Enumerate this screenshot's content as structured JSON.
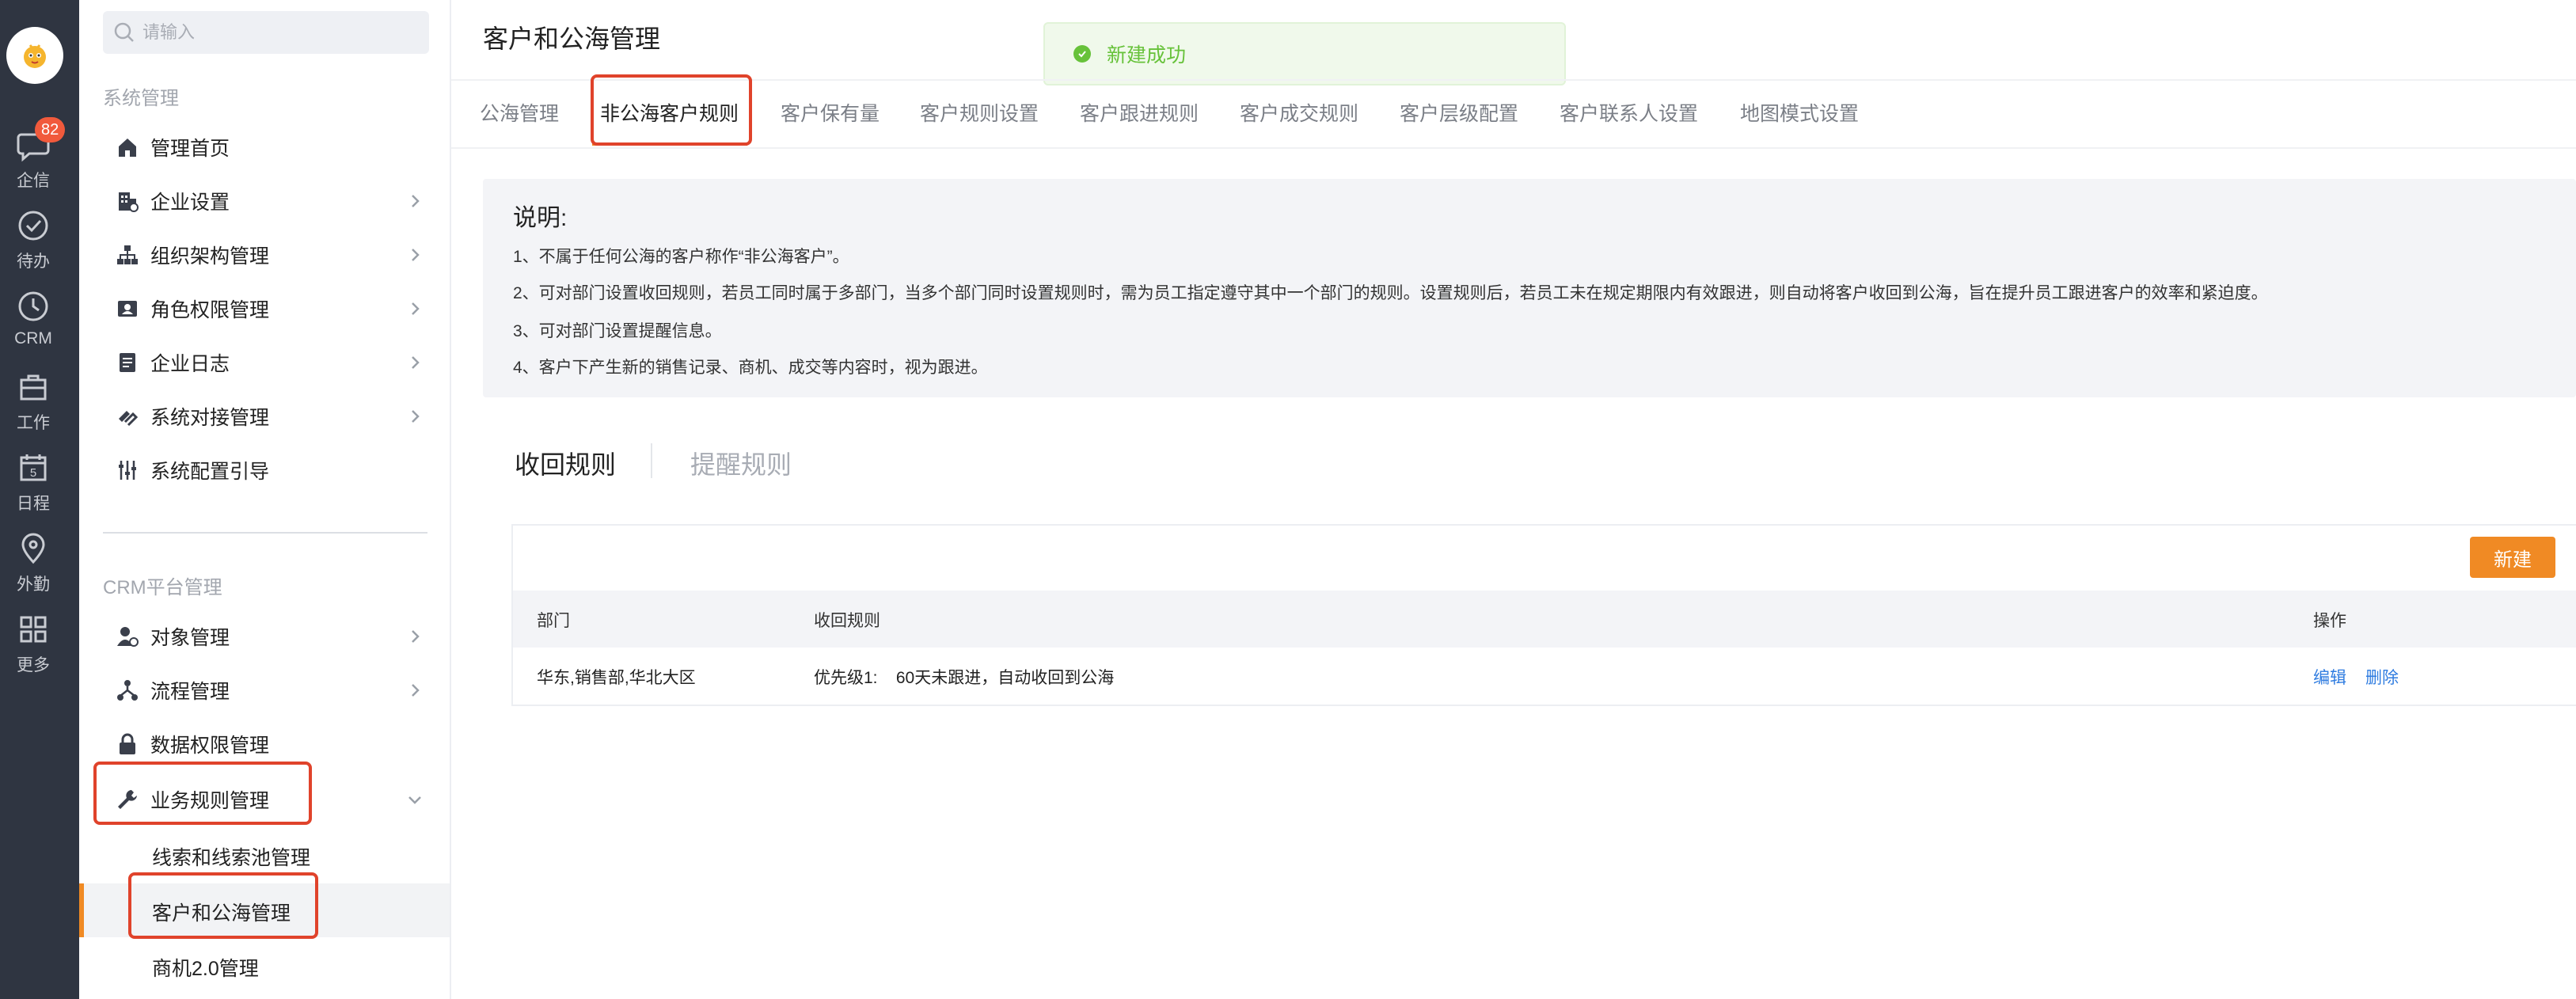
{
  "rail": {
    "badge": "82",
    "items": [
      {
        "label": "企信",
        "icon": "chat-icon"
      },
      {
        "label": "待办",
        "icon": "check-circle-icon"
      },
      {
        "label": "CRM",
        "icon": "clock-icon"
      },
      {
        "label": "工作",
        "icon": "briefcase-icon"
      },
      {
        "label": "日程",
        "icon": "calendar-icon",
        "day": "5"
      },
      {
        "label": "外勤",
        "icon": "location-pin-icon"
      },
      {
        "label": "更多",
        "icon": "grid-icon"
      }
    ]
  },
  "sidebar": {
    "search_placeholder": "请输入",
    "section_system": "系统管理",
    "system_items": [
      {
        "label": "管理首页",
        "icon": "home-icon"
      },
      {
        "label": "企业设置",
        "icon": "building-icon"
      },
      {
        "label": "组织架构管理",
        "icon": "org-chart-icon"
      },
      {
        "label": "角色权限管理",
        "icon": "id-card-icon"
      },
      {
        "label": "企业日志",
        "icon": "document-icon"
      },
      {
        "label": "系统对接管理",
        "icon": "link-icon"
      },
      {
        "label": "系统配置引导",
        "icon": "sliders-icon"
      }
    ],
    "section_crm": "CRM平台管理",
    "crm_items": [
      {
        "label": "对象管理",
        "icon": "user-gear-icon"
      },
      {
        "label": "流程管理",
        "icon": "flow-icon"
      },
      {
        "label": "数据权限管理",
        "icon": "lock-icon"
      },
      {
        "label": "业务规则管理",
        "icon": "wrench-icon"
      }
    ],
    "sub_items": [
      "线索和线索池管理",
      "客户和公海管理",
      "商机2.0管理"
    ]
  },
  "main": {
    "title": "客户和公海管理",
    "toast": "新建成功",
    "tabs": [
      "公海管理",
      "非公海客户规则",
      "客户保有量",
      "客户规则设置",
      "客户跟进规则",
      "客户成交规则",
      "客户层级配置",
      "客户联系人设置",
      "地图模式设置"
    ],
    "desc": {
      "title": "说明:",
      "lines": [
        "1、不属于任何公海的客户称作“非公海客户”。",
        "2、可对部门设置收回规则，若员工同时属于多部门，当多个部门同时设置规则时，需为员工指定遵守其中一个部门的规则。设置规则后，若员工未在规定期限内有效跟进，则自动将客户收回到公海，旨在提升员工跟进客户的效率和紧迫度。",
        "3、可对部门设置提醒信息。",
        "4、客户下产生新的销售记录、商机、成交等内容时，视为跟进。"
      ]
    },
    "subtabs": [
      "收回规则",
      "提醒规则"
    ],
    "new_button": "新建",
    "table": {
      "headers": [
        "部门",
        "收回规则",
        "操作"
      ],
      "rows": [
        {
          "dept": "华东,销售部,华北大区",
          "rule": "优先级1:    60天未跟进，自动收回到公海",
          "edit": "编辑",
          "delete": "删除"
        }
      ]
    }
  },
  "colors": {
    "rail_bg": "#2f3541",
    "accent": "#f08a24",
    "highlight": "#e0432b",
    "link": "#2f7ce0",
    "success": "#67c23a"
  }
}
